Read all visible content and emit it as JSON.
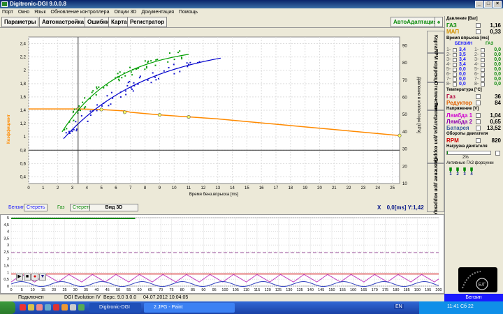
{
  "window": {
    "title": "Digitronic-DGI 9.0.0.8"
  },
  "menu": [
    "Порт",
    "Окно",
    "Язык",
    "Обновление контроллера",
    "Опции 3D",
    "Документация",
    "Помощь"
  ],
  "toolbar": {
    "params": "Параметры",
    "autotune": "Автонастройка",
    "errors": "Ошибки",
    "map": "Карта",
    "recorder": "Регистратор",
    "auto_adapt": "АвтоАдаптация"
  },
  "side_tabs": [
    "Карта",
    "RPM коррекция",
    "Отключение",
    "Температура доп коррекция",
    "Давление доп коррекция"
  ],
  "main_chart": {
    "xlabel": "Время бенз.впрыска [ms]",
    "ylabel_left": "Коэффициент",
    "ylabel_right": "Давление в коллекторе [kPa]",
    "xlim": [
      0,
      25.5
    ],
    "ylim_left": [
      0.3,
      2.5
    ],
    "ylim_right": [
      10,
      95
    ],
    "x_ticks": [
      0,
      1,
      2,
      3,
      4,
      5,
      6,
      7,
      8,
      9,
      10,
      11,
      12,
      13,
      14,
      15,
      16,
      17,
      18,
      19,
      20,
      21,
      22,
      23,
      24,
      25
    ],
    "y_left_ticks": [
      "0,4",
      "0,6",
      "0,8",
      "1",
      "1,2",
      "1,4",
      "1,6",
      "1,8",
      "2",
      "2,2",
      "2,4"
    ],
    "y_right_ticks": [
      "10",
      "20",
      "30",
      "40",
      "50",
      "60",
      "70",
      "80",
      "90"
    ],
    "cursor": {
      "x": 3.4,
      "y": 1.42
    }
  },
  "controls": {
    "petrol_label": "Бензин",
    "petrol_clear": "Стереть",
    "gas_label": "Газ",
    "gas_clear": "Стереть",
    "view3d": "Вид 3D",
    "x_label": "X",
    "coord_text": "0,0[ms] Y:1,42"
  },
  "lower_chart": {
    "x_ticks": [
      "0",
      "5",
      "10",
      "15",
      "20",
      "25",
      "30",
      "35",
      "40",
      "45",
      "50",
      "55",
      "60",
      "65",
      "70",
      "75",
      "80",
      "85",
      "90",
      "95",
      "100",
      "105",
      "110",
      "115",
      "120",
      "125",
      "130",
      "135",
      "140",
      "145",
      "150",
      "155",
      "160",
      "165",
      "170",
      "175",
      "180",
      "185",
      "190",
      "195",
      "200"
    ],
    "y_ticks": [
      "0",
      "0,5",
      "1",
      "1,5",
      "2",
      "2,5",
      "3",
      "3,5",
      "4",
      "4,5",
      "5"
    ]
  },
  "playback": [
    "▶",
    "■",
    "●",
    "▼"
  ],
  "panel": {
    "pressure_h": "Давление [Bar]",
    "gas_l": "ГАЗ",
    "gas_v": "1,16",
    "map_l": "МАП",
    "map_v": "0,33",
    "inj_h": "Время впрыска [ms]",
    "petrol_col": "БЕНЗИН",
    "gas_col": "ГАЗ",
    "injectors": [
      {
        "n": "1",
        "p": "3,4",
        "g": "0,0"
      },
      {
        "n": "2",
        "p": "3,5",
        "g": "0,0"
      },
      {
        "n": "3",
        "p": "3,4",
        "g": "0,0"
      },
      {
        "n": "4",
        "p": "3,4",
        "g": "0,0"
      },
      {
        "n": "5",
        "p": "0,0",
        "g": "0,0"
      },
      {
        "n": "6",
        "p": "0,0",
        "g": "0,0"
      },
      {
        "n": "7",
        "p": "0,0",
        "g": "0,0"
      },
      {
        "n": "8",
        "p": "0,0",
        "g": "0,0"
      }
    ],
    "temp_h": "Температура [°C]",
    "temp_gas_l": "Газ",
    "temp_gas_v": "36",
    "reducer_l": "Редуктор",
    "reducer_v": "84",
    "volt_h": "Напряжение [V]",
    "lambda1_l": "Лямбда 1",
    "lambda1_v": "1,04",
    "lambda2_l": "Лямбда 2",
    "lambda2_v": "0,65",
    "battery_l": "Батарея",
    "battery_v": "13,52",
    "rpm_h": "Обороты двигателя",
    "rpm_l": "RPM",
    "rpm_v": "820",
    "load_h": "Нагрузка двигателя",
    "load_v": "2%",
    "active_h": "Активные ГАЗ форсунки",
    "active": [
      "1",
      "2",
      "3",
      "4"
    ]
  },
  "fuel_status": "Бензин",
  "status": {
    "conn": "Подключен",
    "device": "DGI Evolution IV",
    "version": "Верс. 9.0 3.0.0",
    "date": "04.07.2012 10:04:05"
  },
  "taskbar": {
    "task1": "Digitronic-DGI",
    "task2": "2.JPG - Paint",
    "lang": "EN",
    "clock": "11:41 Сб 22"
  }
}
